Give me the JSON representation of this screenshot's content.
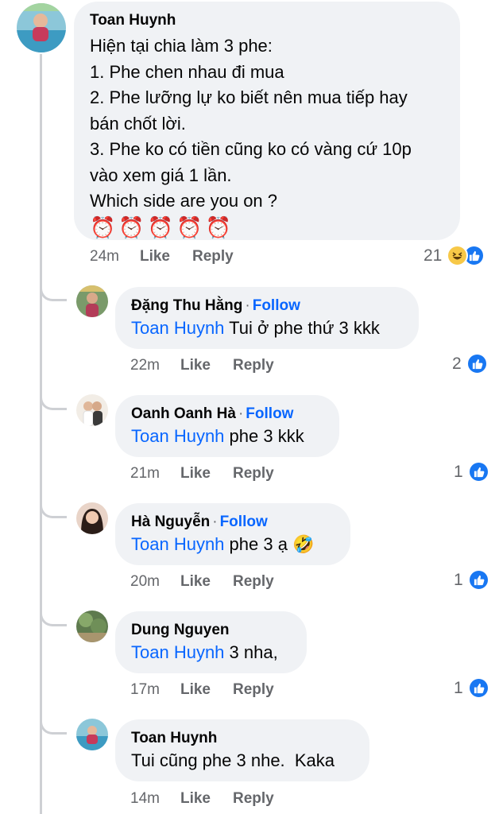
{
  "colors": {
    "link": "#0866ff",
    "bubble": "#f0f2f5",
    "meta": "#65676b",
    "like": "#1877f2"
  },
  "main": {
    "author": "Toan Huynh",
    "lines": [
      "Hiện tại chia làm 3 phe:",
      "1. Phe chen nhau đi mua",
      "2. Phe lưỡng lự ko biết nên mua tiếp hay",
      "bán chốt lời.",
      "3. Phe ko có tiền cũng ko có vàng cứ 10p",
      "vào xem giá 1 lần.",
      "Which side are you on ?"
    ],
    "emojis": [
      "⏰",
      "⏰",
      "⏰",
      "⏰",
      "⏰"
    ],
    "time": "24m",
    "like": "Like",
    "reply": "Reply",
    "reaction_count": "21"
  },
  "replies": [
    {
      "author": "Đặng Thu Hằng",
      "dot": "·",
      "follow": "Follow",
      "mention": "Toan Huynh",
      "text": "Tui ở phe thứ 3 kkk",
      "time": "22m",
      "like": "Like",
      "reply": "Reply",
      "count": "2"
    },
    {
      "author": "Oanh Oanh Hà",
      "dot": "·",
      "follow": "Follow",
      "mention": "Toan Huynh",
      "text": "phe 3 kkk",
      "time": "21m",
      "like": "Like",
      "reply": "Reply",
      "count": "1"
    },
    {
      "author": "Hà Nguyễn",
      "dot": "·",
      "follow": "Follow",
      "mention": "Toan Huynh",
      "text": "phe 3 ạ 🤣",
      "time": "20m",
      "like": "Like",
      "reply": "Reply",
      "count": "1"
    },
    {
      "author": "Dung Nguyen",
      "mention": "Toan Huynh",
      "text": "3 nha,",
      "time": "17m",
      "like": "Like",
      "reply": "Reply",
      "count": "1"
    },
    {
      "author": "Toan Huynh",
      "text": "Tui cũng phe 3 nhe.  Kaka",
      "time": "14m",
      "like": "Like",
      "reply": "Reply"
    }
  ]
}
